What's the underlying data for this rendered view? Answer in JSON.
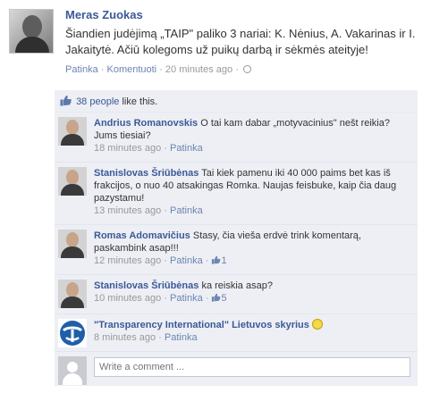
{
  "post": {
    "author": "Meras Zuokas",
    "text": "Šiandien judėjimą „TAIP\" paliko 3 nariai: K. Nėnius, A. Vakarinas ir I. Jakaitytė. Ačiū kolegoms už puikų darbą ir sėkmės ateityje!",
    "like_label": "Patinka",
    "separator": " · ",
    "comment_label": "Komentuoti",
    "time": "20 minutes ago",
    "trail": " ·"
  },
  "likes": {
    "count_text": "38 people",
    "suffix": " like this."
  },
  "comments": [
    {
      "author": "Andrius Romanovskis",
      "text": "O tai kam dabar „motyvacinius\" nešt reikia? Jums tiesiai?",
      "time": "18 minutes ago",
      "like_label": "Patinka",
      "likes": ""
    },
    {
      "author": "Stanislovas Šriūbėnas",
      "text": "Tai kiek pamenu iki 40 000 paims bet kas iš frakcijos, o nuo 40 atsakingas Romka. Naujas feisbuke, kaip čia daug pazystamu!",
      "time": "13 minutes ago",
      "like_label": "Patinka",
      "likes": ""
    },
    {
      "author": "Romas Adomavičius",
      "text": "Stasy, čia vieša erdvė trink komentarą, paskambink asap!!!",
      "time": "12 minutes ago",
      "like_label": "Patinka",
      "likes": "1"
    },
    {
      "author": "Stanislovas Šriūbėnas",
      "text": "ka reiskia asap?",
      "time": "10 minutes ago",
      "like_label": "Patinka",
      "likes": "5"
    },
    {
      "author": "\"Transparency International\" Lietuvos skyrius",
      "text": "",
      "time": "8 minutes ago",
      "like_label": "Patinka",
      "likes": ""
    }
  ],
  "write_comment": {
    "placeholder": "Write a comment ..."
  },
  "colors": {
    "link": "#3b5998",
    "ufi_bg": "#edeff4",
    "meta": "#999999"
  }
}
